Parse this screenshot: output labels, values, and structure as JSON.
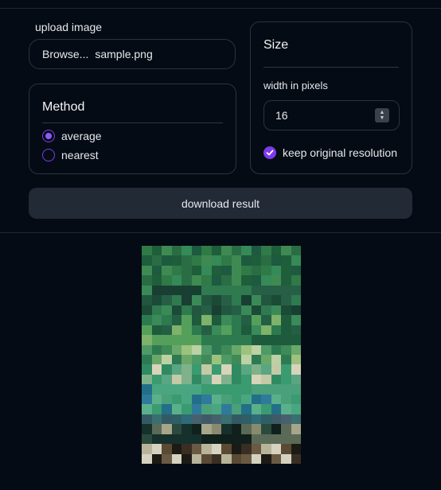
{
  "upload": {
    "label": "upload image",
    "browse_label": "Browse...",
    "file_name": "sample.png"
  },
  "method": {
    "title": "Method",
    "options": [
      {
        "label": "average",
        "selected": true
      },
      {
        "label": "nearest",
        "selected": false
      }
    ]
  },
  "size": {
    "title": "Size",
    "width_label": "width in pixels",
    "width_value": "16",
    "keep_label": "keep original resolution",
    "keep_checked": true
  },
  "actions": {
    "download_label": "download result"
  },
  "result_image": {
    "columns": 16,
    "rows": 22
  },
  "colors": {
    "background": "#050b14",
    "accent": "#7c3aed",
    "button": "#222a36",
    "border": "#2b3340"
  }
}
